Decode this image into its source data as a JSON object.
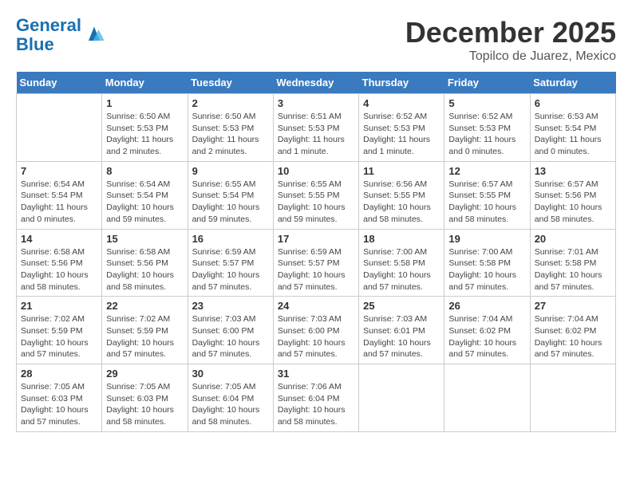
{
  "header": {
    "logo_line1": "General",
    "logo_line2": "Blue",
    "title": "December 2025",
    "subtitle": "Topilco de Juarez, Mexico"
  },
  "calendar": {
    "days_header": [
      "Sunday",
      "Monday",
      "Tuesday",
      "Wednesday",
      "Thursday",
      "Friday",
      "Saturday"
    ],
    "weeks": [
      [
        {
          "day": "",
          "info": ""
        },
        {
          "day": "1",
          "info": "Sunrise: 6:50 AM\nSunset: 5:53 PM\nDaylight: 11 hours\nand 2 minutes."
        },
        {
          "day": "2",
          "info": "Sunrise: 6:50 AM\nSunset: 5:53 PM\nDaylight: 11 hours\nand 2 minutes."
        },
        {
          "day": "3",
          "info": "Sunrise: 6:51 AM\nSunset: 5:53 PM\nDaylight: 11 hours\nand 1 minute."
        },
        {
          "day": "4",
          "info": "Sunrise: 6:52 AM\nSunset: 5:53 PM\nDaylight: 11 hours\nand 1 minute."
        },
        {
          "day": "5",
          "info": "Sunrise: 6:52 AM\nSunset: 5:53 PM\nDaylight: 11 hours\nand 0 minutes."
        },
        {
          "day": "6",
          "info": "Sunrise: 6:53 AM\nSunset: 5:54 PM\nDaylight: 11 hours\nand 0 minutes."
        }
      ],
      [
        {
          "day": "7",
          "info": "Sunrise: 6:54 AM\nSunset: 5:54 PM\nDaylight: 11 hours\nand 0 minutes."
        },
        {
          "day": "8",
          "info": "Sunrise: 6:54 AM\nSunset: 5:54 PM\nDaylight: 10 hours\nand 59 minutes."
        },
        {
          "day": "9",
          "info": "Sunrise: 6:55 AM\nSunset: 5:54 PM\nDaylight: 10 hours\nand 59 minutes."
        },
        {
          "day": "10",
          "info": "Sunrise: 6:55 AM\nSunset: 5:55 PM\nDaylight: 10 hours\nand 59 minutes."
        },
        {
          "day": "11",
          "info": "Sunrise: 6:56 AM\nSunset: 5:55 PM\nDaylight: 10 hours\nand 58 minutes."
        },
        {
          "day": "12",
          "info": "Sunrise: 6:57 AM\nSunset: 5:55 PM\nDaylight: 10 hours\nand 58 minutes."
        },
        {
          "day": "13",
          "info": "Sunrise: 6:57 AM\nSunset: 5:56 PM\nDaylight: 10 hours\nand 58 minutes."
        }
      ],
      [
        {
          "day": "14",
          "info": "Sunrise: 6:58 AM\nSunset: 5:56 PM\nDaylight: 10 hours\nand 58 minutes."
        },
        {
          "day": "15",
          "info": "Sunrise: 6:58 AM\nSunset: 5:56 PM\nDaylight: 10 hours\nand 58 minutes."
        },
        {
          "day": "16",
          "info": "Sunrise: 6:59 AM\nSunset: 5:57 PM\nDaylight: 10 hours\nand 57 minutes."
        },
        {
          "day": "17",
          "info": "Sunrise: 6:59 AM\nSunset: 5:57 PM\nDaylight: 10 hours\nand 57 minutes."
        },
        {
          "day": "18",
          "info": "Sunrise: 7:00 AM\nSunset: 5:58 PM\nDaylight: 10 hours\nand 57 minutes."
        },
        {
          "day": "19",
          "info": "Sunrise: 7:00 AM\nSunset: 5:58 PM\nDaylight: 10 hours\nand 57 minutes."
        },
        {
          "day": "20",
          "info": "Sunrise: 7:01 AM\nSunset: 5:58 PM\nDaylight: 10 hours\nand 57 minutes."
        }
      ],
      [
        {
          "day": "21",
          "info": "Sunrise: 7:02 AM\nSunset: 5:59 PM\nDaylight: 10 hours\nand 57 minutes."
        },
        {
          "day": "22",
          "info": "Sunrise: 7:02 AM\nSunset: 5:59 PM\nDaylight: 10 hours\nand 57 minutes."
        },
        {
          "day": "23",
          "info": "Sunrise: 7:03 AM\nSunset: 6:00 PM\nDaylight: 10 hours\nand 57 minutes."
        },
        {
          "day": "24",
          "info": "Sunrise: 7:03 AM\nSunset: 6:00 PM\nDaylight: 10 hours\nand 57 minutes."
        },
        {
          "day": "25",
          "info": "Sunrise: 7:03 AM\nSunset: 6:01 PM\nDaylight: 10 hours\nand 57 minutes."
        },
        {
          "day": "26",
          "info": "Sunrise: 7:04 AM\nSunset: 6:02 PM\nDaylight: 10 hours\nand 57 minutes."
        },
        {
          "day": "27",
          "info": "Sunrise: 7:04 AM\nSunset: 6:02 PM\nDaylight: 10 hours\nand 57 minutes."
        }
      ],
      [
        {
          "day": "28",
          "info": "Sunrise: 7:05 AM\nSunset: 6:03 PM\nDaylight: 10 hours\nand 57 minutes."
        },
        {
          "day": "29",
          "info": "Sunrise: 7:05 AM\nSunset: 6:03 PM\nDaylight: 10 hours\nand 58 minutes."
        },
        {
          "day": "30",
          "info": "Sunrise: 7:05 AM\nSunset: 6:04 PM\nDaylight: 10 hours\nand 58 minutes."
        },
        {
          "day": "31",
          "info": "Sunrise: 7:06 AM\nSunset: 6:04 PM\nDaylight: 10 hours\nand 58 minutes."
        },
        {
          "day": "",
          "info": ""
        },
        {
          "day": "",
          "info": ""
        },
        {
          "day": "",
          "info": ""
        }
      ]
    ]
  }
}
